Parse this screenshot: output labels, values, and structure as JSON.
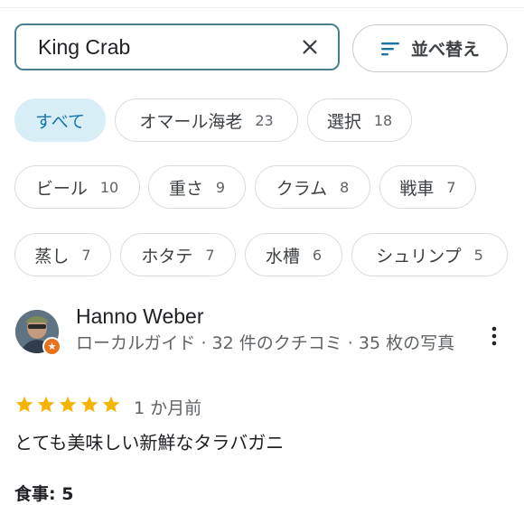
{
  "search": {
    "value": "King Crab"
  },
  "sort": {
    "label": "並べ替え",
    "icon": "sort-icon"
  },
  "chips": [
    {
      "label": "すべて",
      "count": "",
      "selected": true
    },
    {
      "label": "オマール海老",
      "count": "23",
      "selected": false
    },
    {
      "label": "選択",
      "count": "18",
      "selected": false
    },
    {
      "label": "ビール",
      "count": "10",
      "selected": false
    },
    {
      "label": "重さ",
      "count": "9",
      "selected": false
    },
    {
      "label": "クラム",
      "count": "8",
      "selected": false
    },
    {
      "label": "戦車",
      "count": "7",
      "selected": false
    },
    {
      "label": "蒸し",
      "count": "7",
      "selected": false
    },
    {
      "label": "ホタテ",
      "count": "7",
      "selected": false
    },
    {
      "label": "水槽",
      "count": "6",
      "selected": false
    },
    {
      "label": "シュリンプ",
      "count": "5",
      "selected": false
    }
  ],
  "review": {
    "name": "Hanno Weber",
    "meta": "ローカルガイド · 32 件のクチコミ · 35 枚の写真",
    "rating": 5,
    "date": "1 か月前",
    "text": "とても美味しい新鮮なタラバガニ",
    "food_label": "食事: 5"
  },
  "colors": {
    "accent_border": "#4a7f93",
    "selected_chip_bg": "#d7eef7",
    "star": "#f4b400",
    "local_guide_badge": "#e8711c"
  }
}
